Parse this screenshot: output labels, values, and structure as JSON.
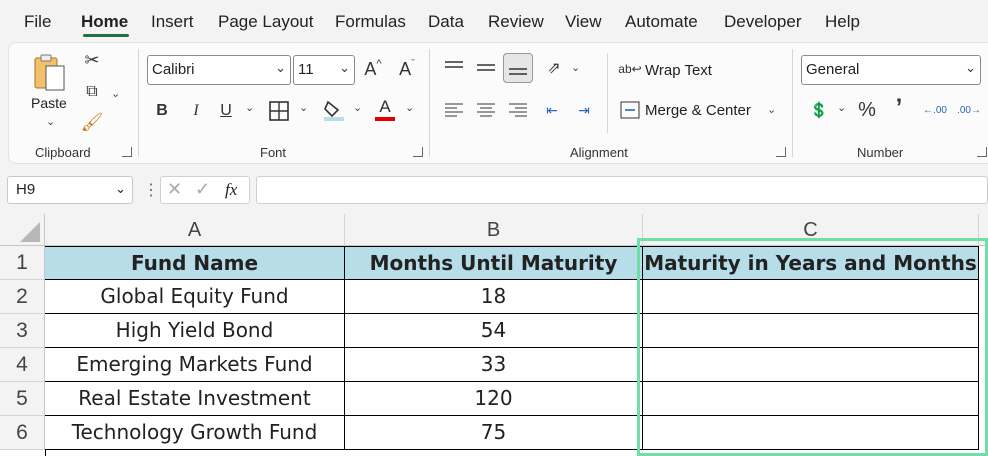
{
  "menu": {
    "tabs": [
      "File",
      "Home",
      "Insert",
      "Page Layout",
      "Formulas",
      "Data",
      "Review",
      "View",
      "Automate",
      "Developer",
      "Help"
    ],
    "active": "Home"
  },
  "ribbon": {
    "clipboard": {
      "label": "Clipboard",
      "paste_label": "Paste"
    },
    "font": {
      "label": "Font",
      "font_name": "Calibri",
      "font_size": "11",
      "bold": "B",
      "italic": "I",
      "underline": "U",
      "grow": "A",
      "shrink": "A",
      "font_color": "A"
    },
    "alignment": {
      "label": "Alignment",
      "wrap_text": "Wrap Text",
      "merge_center": "Merge & Center"
    },
    "number": {
      "label": "Number",
      "format": "General",
      "percent": "%",
      "comma": "’"
    }
  },
  "formula_bar": {
    "name_box": "H9",
    "fx": "fx",
    "formula": ""
  },
  "sheet": {
    "columns": [
      "A",
      "B",
      "C"
    ],
    "rows": [
      "1",
      "2",
      "3",
      "4",
      "5",
      "6"
    ],
    "header": [
      "Fund Name",
      "Months Until Maturity",
      "Maturity in Years and Months"
    ],
    "data": [
      [
        "Global Equity Fund",
        "18",
        ""
      ],
      [
        "High Yield Bond",
        "54",
        ""
      ],
      [
        "Emerging Markets Fund",
        "33",
        ""
      ],
      [
        "Real Estate Investment",
        "120",
        ""
      ],
      [
        "Technology Growth Fund",
        "75",
        ""
      ]
    ]
  },
  "colors": {
    "accent": "#1e7145",
    "header_fill": "#b7dde8",
    "selection": "#6fdeaa",
    "font_color_bar": "#e00000"
  }
}
